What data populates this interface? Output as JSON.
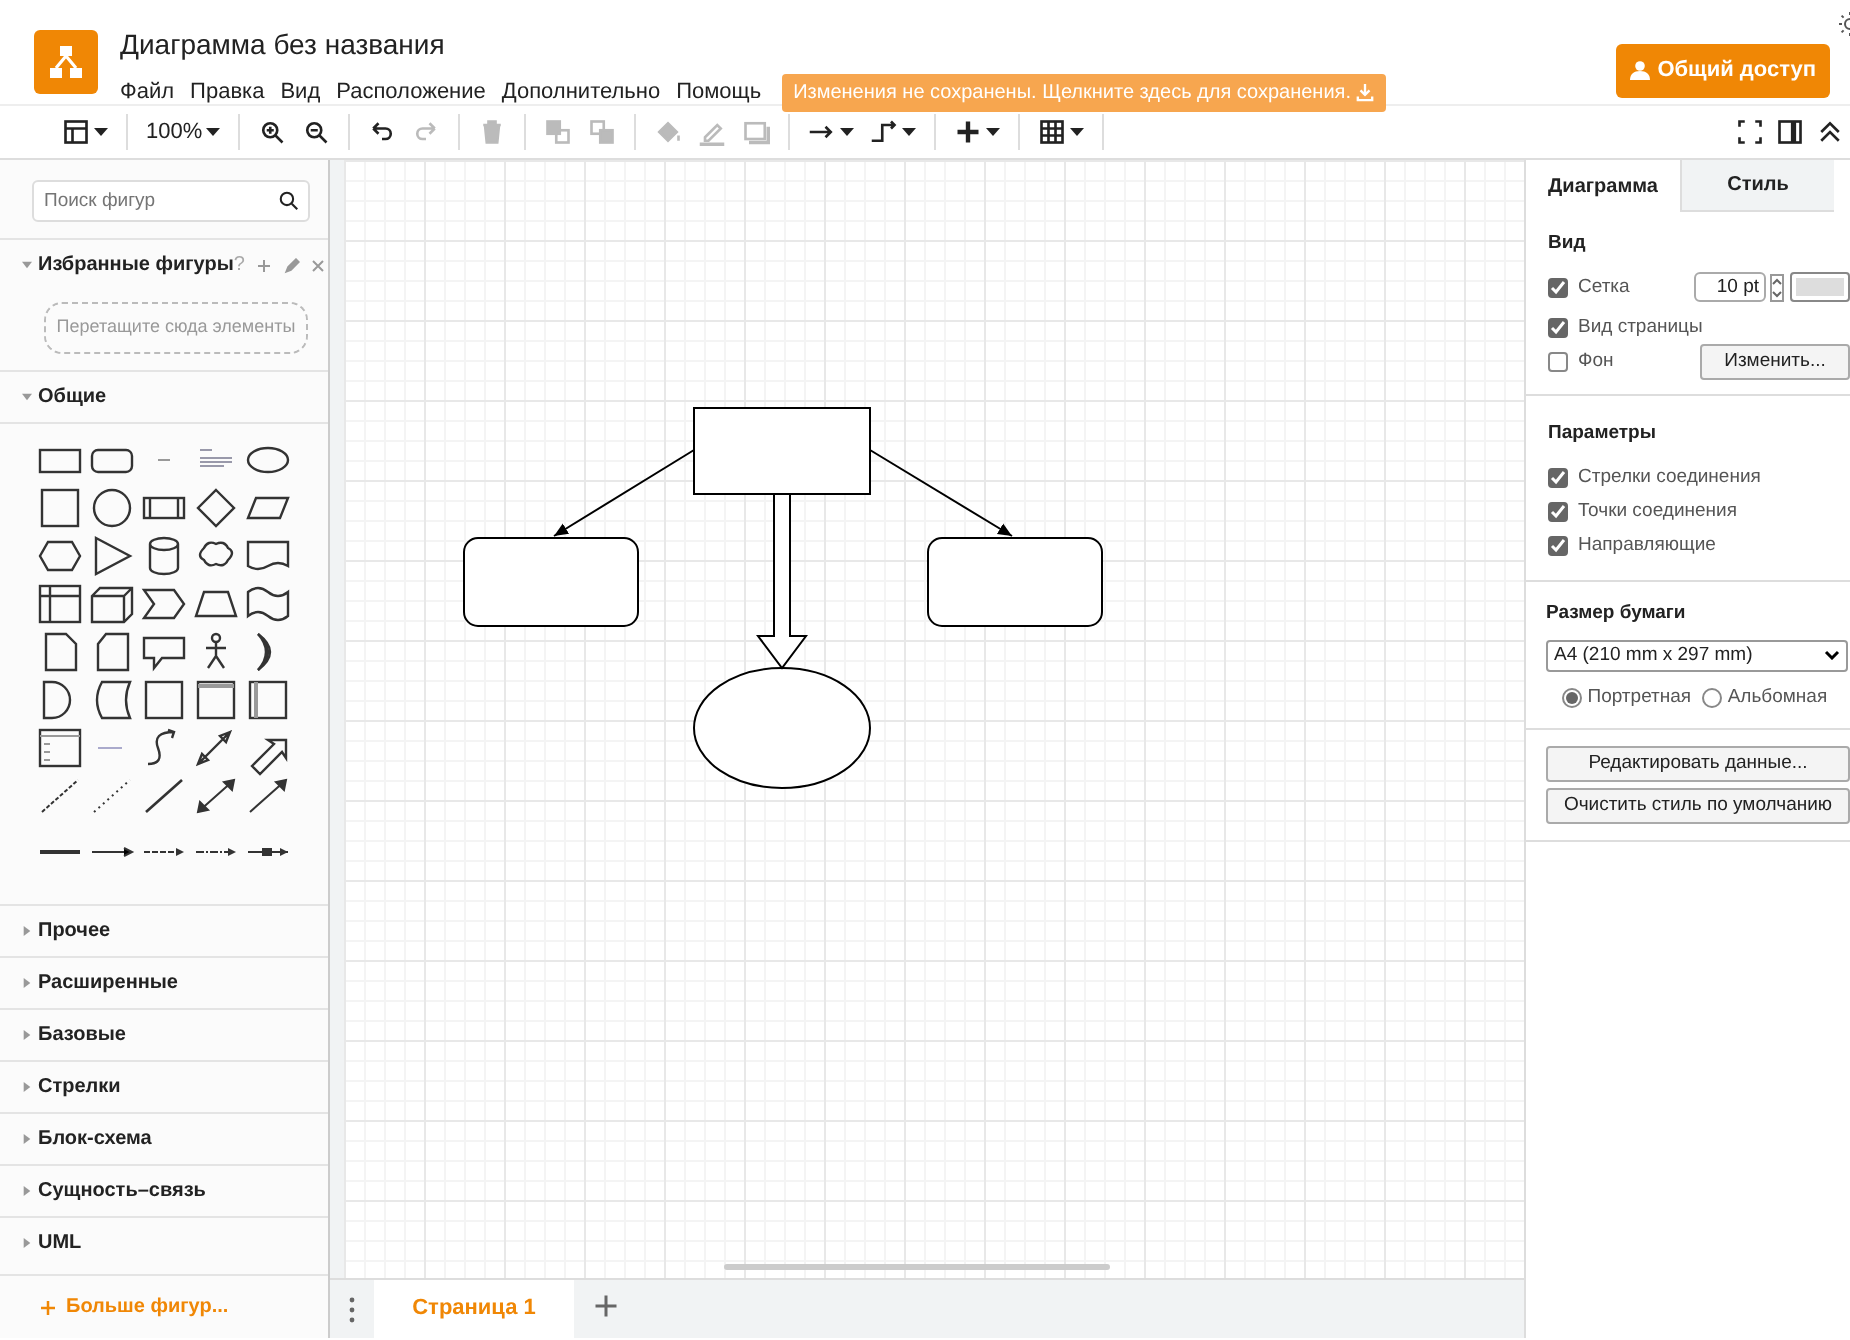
{
  "app": {
    "title": "Диаграмма без названия",
    "menu": [
      "Файл",
      "Правка",
      "Вид",
      "Расположение",
      "Дополнительно",
      "Помощь"
    ],
    "save_notice": "Изменения не сохранены. Щелкните здесь для сохранения.",
    "share_button": "Общий доступ"
  },
  "toolbar": [
    [
      {
        "kind": "format",
        "disabled": false
      }
    ],
    [
      {
        "kind": "zoom",
        "label": "100%",
        "disabled": false
      }
    ],
    [
      {
        "kind": "zoom-in",
        "disabled": false
      },
      {
        "kind": "zoom-out",
        "disabled": false
      }
    ],
    [
      {
        "kind": "undo",
        "disabled": false
      },
      {
        "kind": "redo",
        "disabled": true
      }
    ],
    [
      {
        "kind": "delete",
        "disabled": true
      }
    ],
    [
      {
        "kind": "to-front",
        "disabled": true
      },
      {
        "kind": "to-back",
        "disabled": true
      }
    ],
    [
      {
        "kind": "fill",
        "disabled": true
      },
      {
        "kind": "line",
        "disabled": true
      },
      {
        "kind": "shadow",
        "disabled": true
      }
    ],
    [
      {
        "kind": "connection",
        "disabled": false
      },
      {
        "kind": "waypoints",
        "disabled": false
      }
    ],
    [
      {
        "kind": "insert",
        "disabled": false
      }
    ],
    [
      {
        "kind": "table",
        "disabled": false
      }
    ]
  ],
  "toolbar_right": [
    {
      "kind": "fullscreen",
      "disabled": false
    },
    {
      "kind": "panel",
      "disabled": false
    },
    {
      "kind": "collapse",
      "disabled": false
    }
  ],
  "sidebar": {
    "search": {
      "placeholder": "Поиск фигур"
    },
    "favorites": {
      "title": "Избранные фигуры",
      "help": "?",
      "drop_hint": "Перетащите сюда элементы",
      "expanded": true
    },
    "general": {
      "title": "Общие",
      "expanded": true
    },
    "sections": [
      {
        "title": "Прочее",
        "expanded": false
      },
      {
        "title": "Расширенные",
        "expanded": false
      },
      {
        "title": "Базовые",
        "expanded": false
      },
      {
        "title": "Стрелки",
        "expanded": false
      },
      {
        "title": "Блок-схема",
        "expanded": false
      },
      {
        "title": "Сущность–связь",
        "expanded": false
      },
      {
        "title": "UML",
        "expanded": false
      }
    ],
    "more_shapes": "Больше фигур..."
  },
  "pages": [
    {
      "label": "Страница 1",
      "selected": true
    }
  ],
  "panel": {
    "tabs": [
      {
        "label": "Диаграмма",
        "selected": true
      },
      {
        "label": "Стиль",
        "selected": false
      }
    ],
    "view": {
      "title": "Вид",
      "grid": {
        "label": "Сетка",
        "checked": true,
        "size": "10 pt"
      },
      "page_view": {
        "label": "Вид страницы",
        "checked": true
      },
      "background": {
        "label": "Фон",
        "checked": false,
        "button": "Изменить..."
      }
    },
    "options": {
      "title": "Параметры",
      "items": [
        {
          "label": "Стрелки соединения",
          "checked": true
        },
        {
          "label": "Точки соединения",
          "checked": true
        },
        {
          "label": "Направляющие",
          "checked": true
        }
      ]
    },
    "paper": {
      "title": "Размер бумаги",
      "size": "A4 (210 mm x 297 mm)",
      "orientations": [
        {
          "label": "Портретная",
          "selected": true
        },
        {
          "label": "Альбомная",
          "selected": false
        }
      ]
    },
    "buttons": [
      "Редактировать данные...",
      "Очистить стиль по умолчанию"
    ]
  }
}
